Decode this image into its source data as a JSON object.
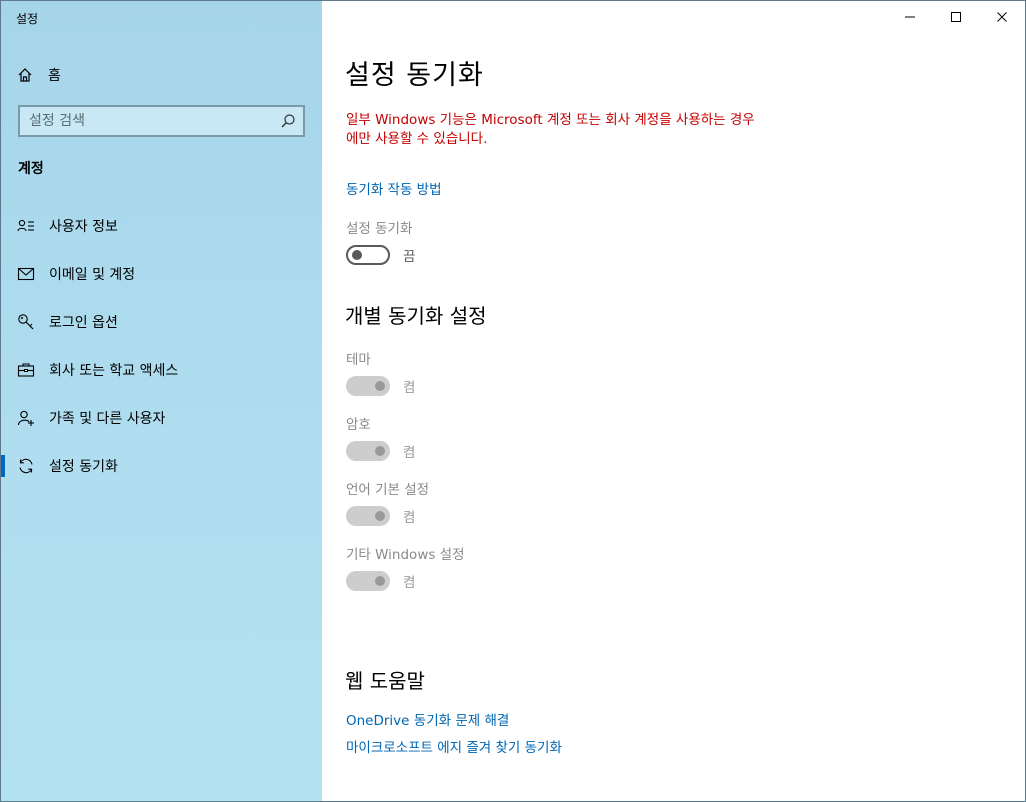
{
  "window": {
    "title": "설정"
  },
  "sidebar": {
    "home_label": "홈",
    "search_placeholder": "설정 검색",
    "section_label": "계정",
    "items": [
      {
        "label": "사용자 정보",
        "icon": "user-info-icon"
      },
      {
        "label": "이메일 및 계정",
        "icon": "mail-icon"
      },
      {
        "label": "로그인 옵션",
        "icon": "key-icon"
      },
      {
        "label": "회사 또는 학교 액세스",
        "icon": "briefcase-icon"
      },
      {
        "label": "가족 및 다른 사용자",
        "icon": "person-add-icon"
      },
      {
        "label": "설정 동기화",
        "icon": "sync-icon",
        "active": true
      }
    ]
  },
  "main": {
    "title": "설정 동기화",
    "warning_line1": "일부 Windows 기능은 Microsoft 계정 또는 회사 계정을 사용하는 경우",
    "warning_line2": "에만 사용할 수 있습니다.",
    "how_link": "동기화 작동 방법",
    "sync_setting": {
      "label": "설정 동기화",
      "state": "끔",
      "on": false
    },
    "individual_title": "개별 동기화 설정",
    "individual": [
      {
        "label": "테마",
        "state": "켬"
      },
      {
        "label": "암호",
        "state": "켬"
      },
      {
        "label": "언어 기본 설정",
        "state": "켬"
      },
      {
        "label": "기타 Windows 설정",
        "state": "켬"
      }
    ],
    "web_help_title": "웹 도움말",
    "web_links": [
      "OneDrive 동기화 문제 해결",
      "마이크로소프트 에지 즐겨 찾기 동기화"
    ]
  },
  "colors": {
    "sidebar_bg": "#a6d5ea",
    "accent": "#0067c0",
    "link": "#0066b4",
    "warning": "#c40000"
  }
}
